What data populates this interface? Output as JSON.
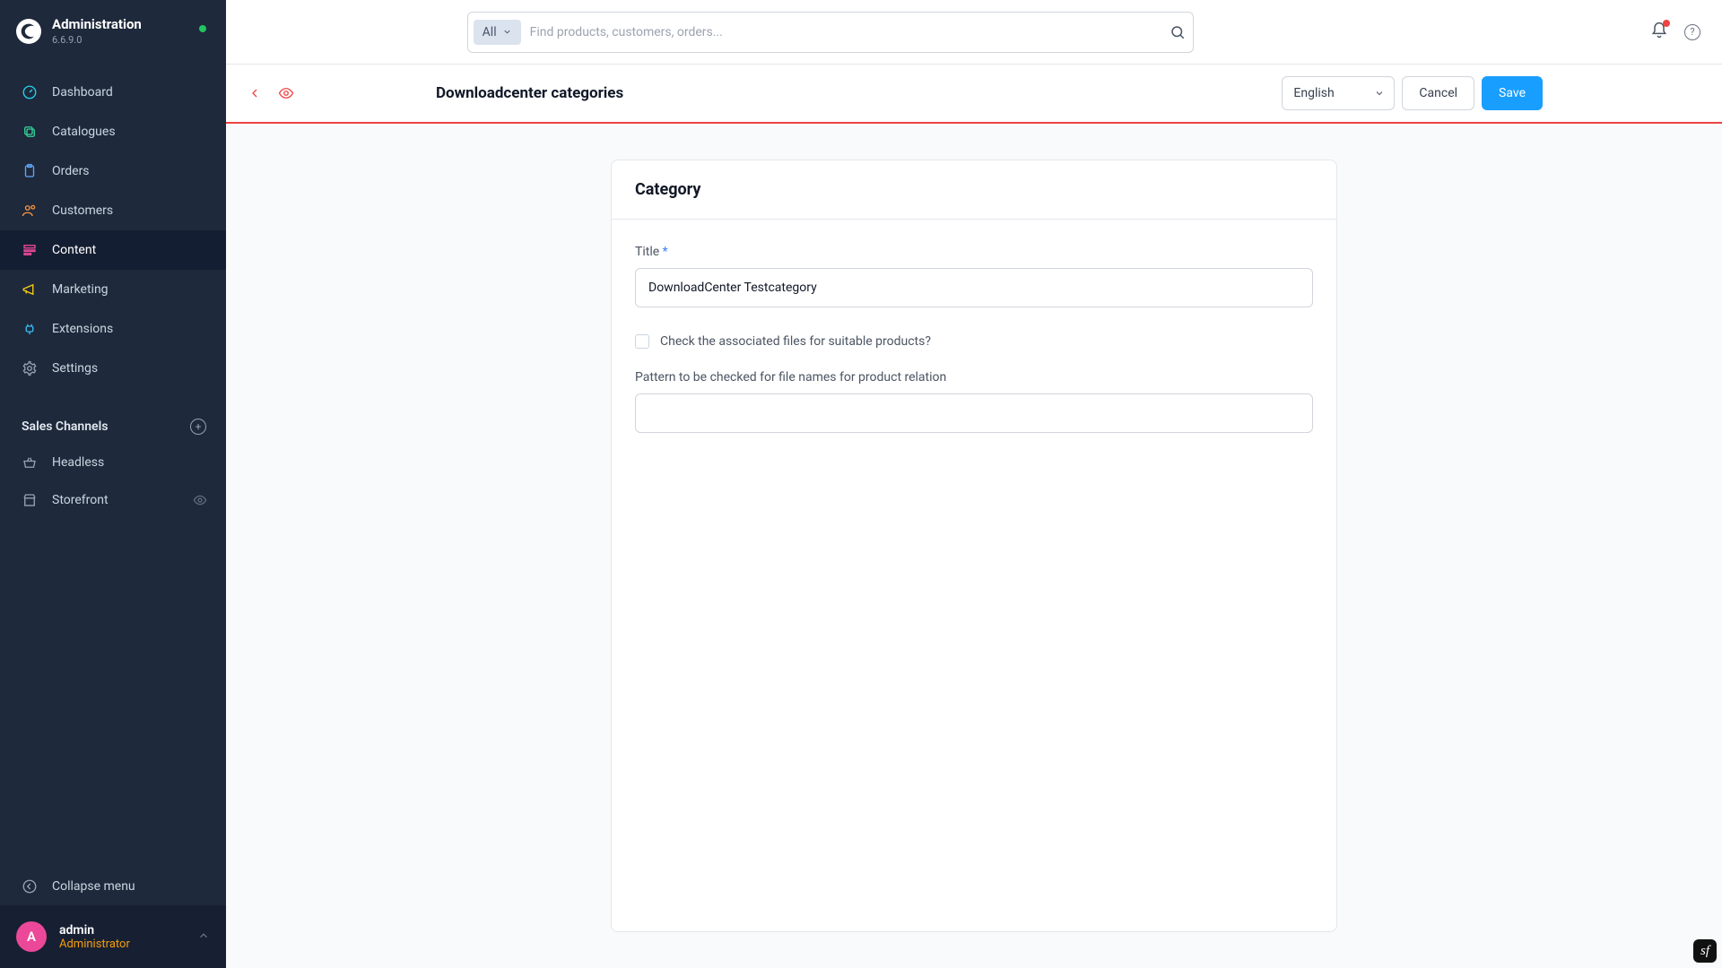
{
  "app": {
    "title": "Administration",
    "version": "6.6.9.0"
  },
  "search": {
    "type_label": "All",
    "placeholder": "Find products, customers, orders..."
  },
  "nav": {
    "items": [
      {
        "label": "Dashboard"
      },
      {
        "label": "Catalogues"
      },
      {
        "label": "Orders"
      },
      {
        "label": "Customers"
      },
      {
        "label": "Content"
      },
      {
        "label": "Marketing"
      },
      {
        "label": "Extensions"
      },
      {
        "label": "Settings"
      }
    ]
  },
  "sales_channels": {
    "title": "Sales Channels",
    "items": [
      {
        "label": "Headless"
      },
      {
        "label": "Storefront"
      }
    ]
  },
  "collapse_label": "Collapse menu",
  "user": {
    "initial": "A",
    "name": "admin",
    "role": "Administrator"
  },
  "page": {
    "title": "Downloadcenter categories",
    "language": "English",
    "cancel": "Cancel",
    "save": "Save"
  },
  "card": {
    "heading": "Category",
    "title_label": "Title",
    "title_value": "DownloadCenter Testcategory",
    "check_label": "Check the associated files for suitable products?",
    "pattern_label": "Pattern to be checked for file names for product relation",
    "pattern_value": ""
  }
}
